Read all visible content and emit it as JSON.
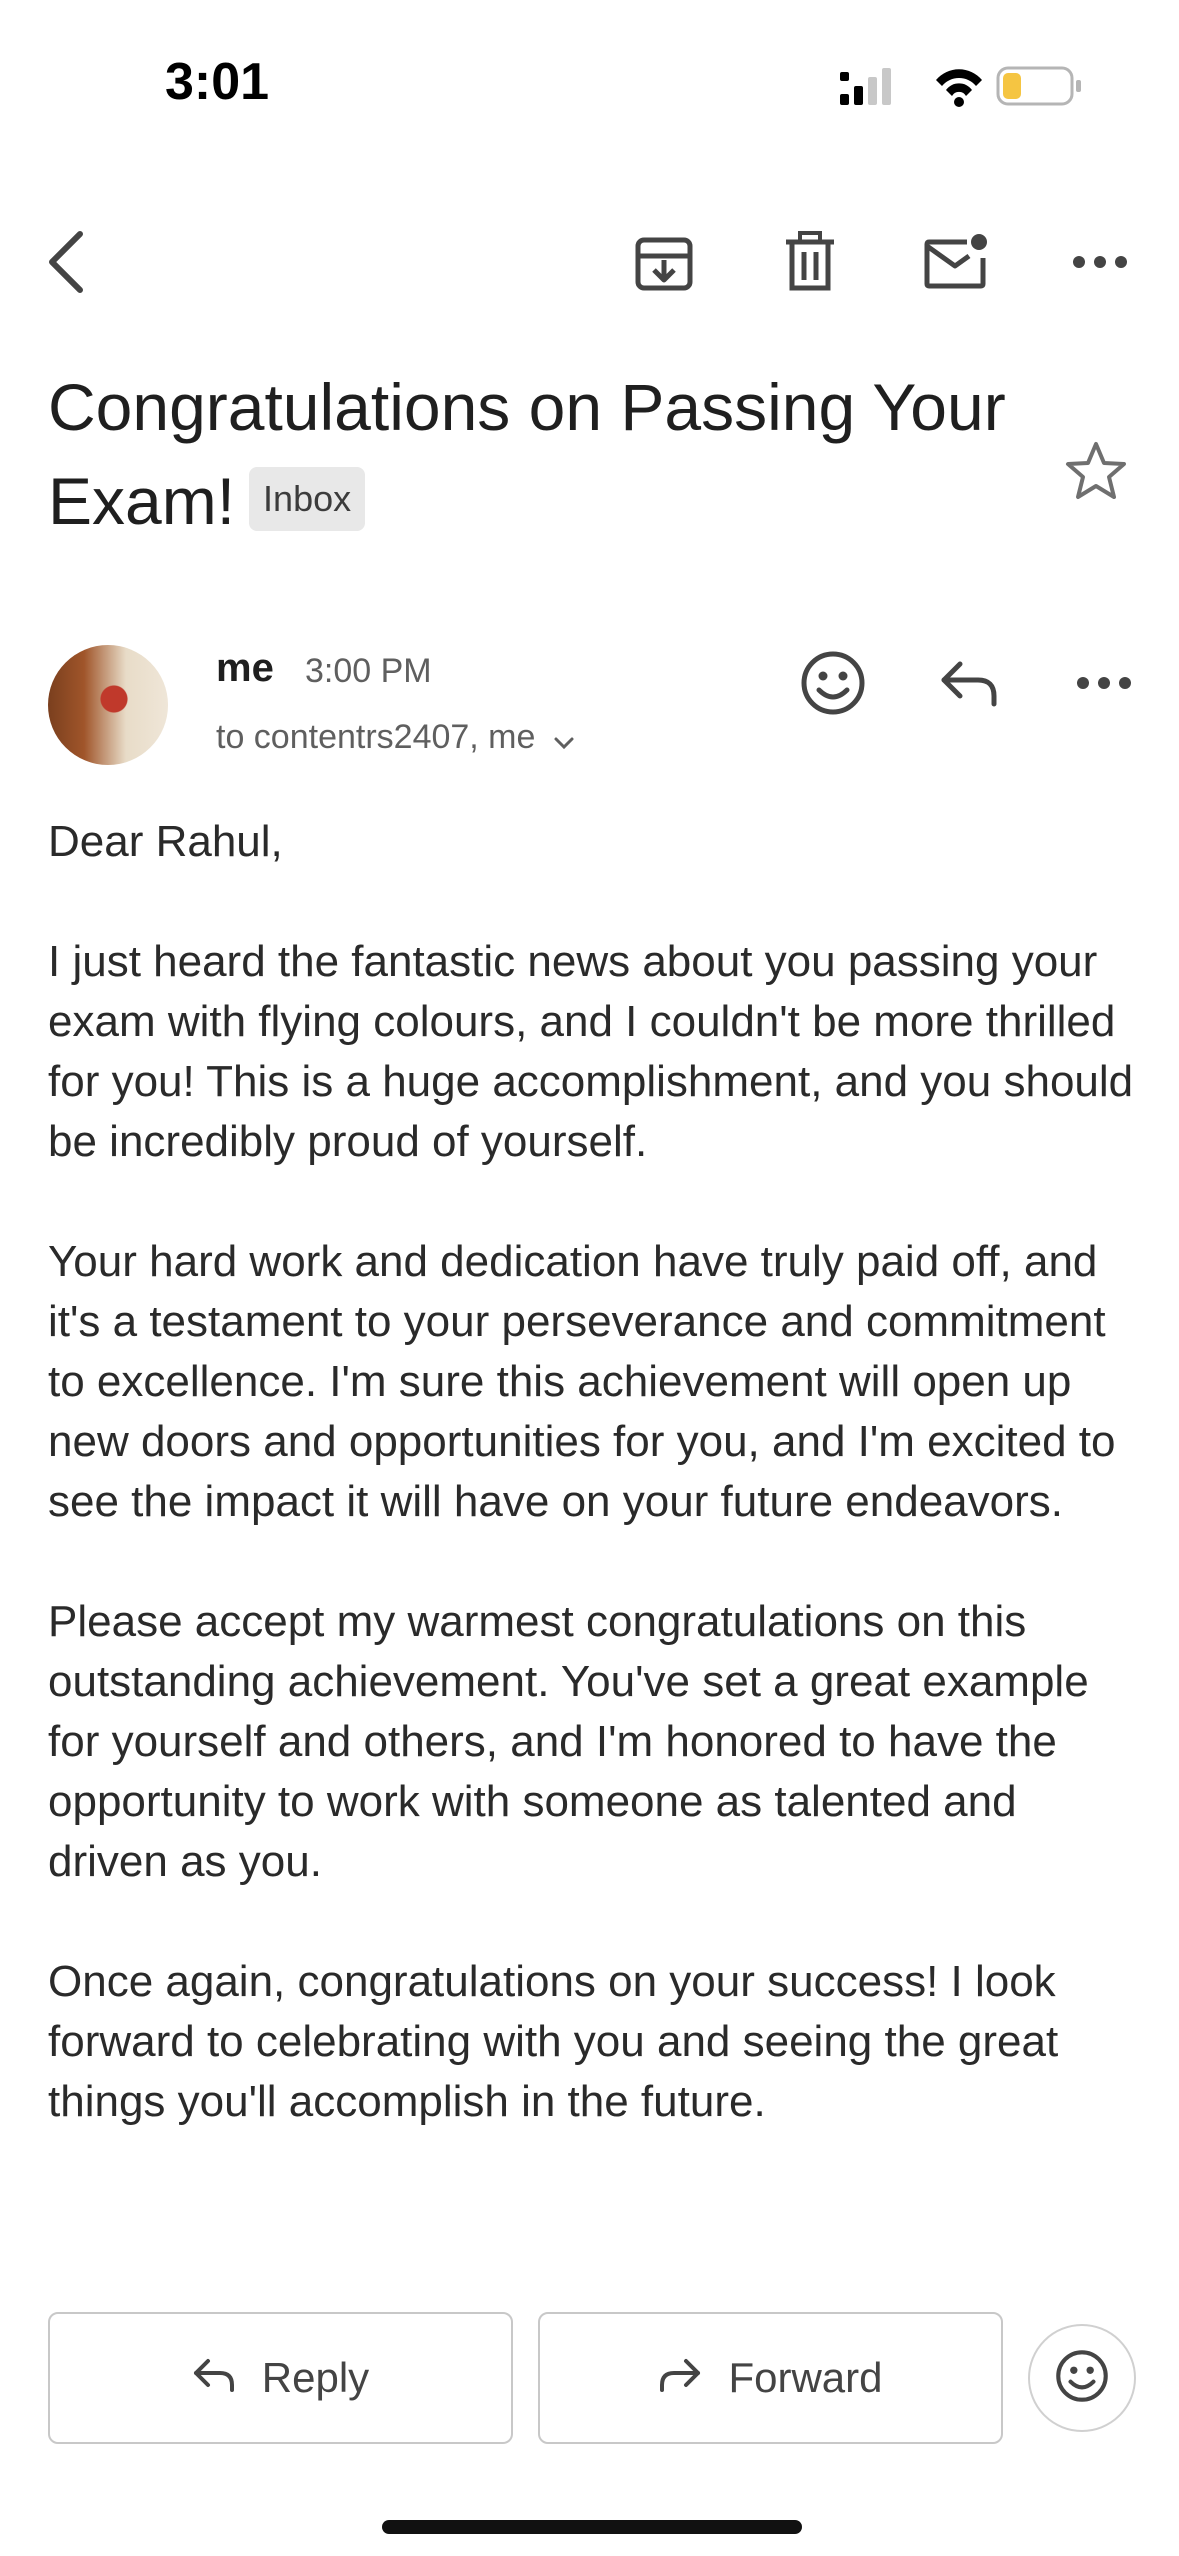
{
  "status_bar": {
    "time": "3:01",
    "icons": [
      "cellular-signal-icon",
      "wifi-icon",
      "battery-low-icon"
    ],
    "battery_color": "#f5c542"
  },
  "toolbar": {
    "icons": [
      "back-icon",
      "archive-icon",
      "delete-icon",
      "mark-unread-icon",
      "more-icon"
    ]
  },
  "email": {
    "subject": "Congratulations on Passing Your Exam!",
    "label": "Inbox",
    "sender": {
      "name": "me",
      "time": "3:00 PM",
      "to": "to contentrs2407, me"
    },
    "greeting": "Dear Rahul,",
    "paragraphs": [
      "I just heard the fantastic news about you passing your exam with flying colours, and I couldn't be more thrilled for you! This is a huge accomplishment, and you should be incredibly proud of yourself.",
      "Your hard work and dedication have truly paid off, and it's a testament to your perseverance and commitment to excellence. I'm sure this achievement will open up new doors and opportunities for you, and I'm excited to see the impact it will have on your future endeavors.",
      "Please accept my warmest congratulations on this outstanding achievement. You've set a great example for yourself and others, and I'm honored to have the opportunity to work with someone as talented and driven as you.",
      "Once again, congratulations on your success! I look forward to celebrating with you and seeing the great things you'll accomplish in the future."
    ]
  },
  "actions": {
    "reply_label": "Reply",
    "forward_label": "Forward"
  }
}
